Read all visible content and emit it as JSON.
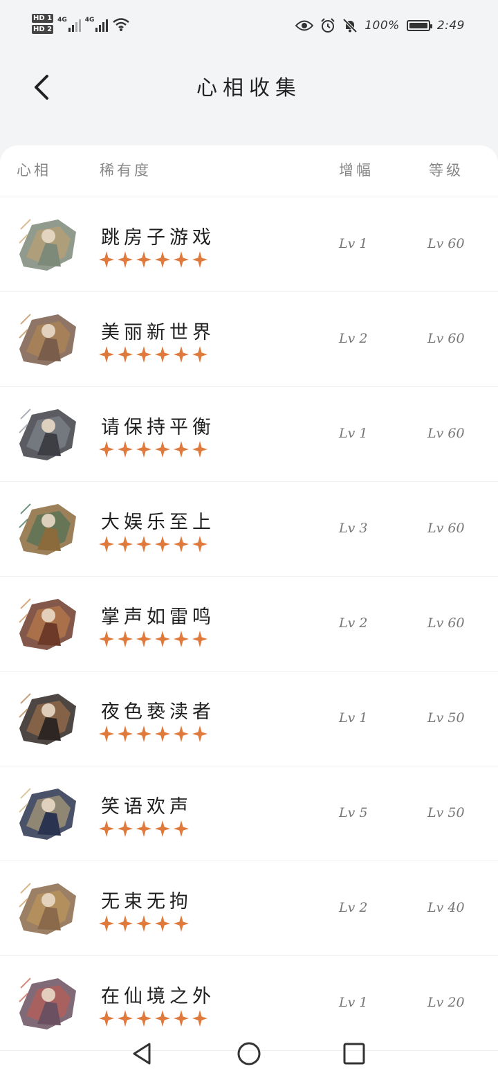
{
  "status_bar": {
    "hd1": "HD 1",
    "hd2": "HD 2",
    "net1": "4G",
    "net2": "4G",
    "battery": "100%",
    "time": "2:49"
  },
  "header": {
    "title": "心相收集"
  },
  "table": {
    "columns": [
      "心相",
      "稀有度",
      "增幅",
      "等级"
    ],
    "rows": [
      {
        "name": "跳房子游戏",
        "stars": 6,
        "boost": "Lv 1",
        "level": "Lv 60"
      },
      {
        "name": "美丽新世界",
        "stars": 6,
        "boost": "Lv 2",
        "level": "Lv 60"
      },
      {
        "name": "请保持平衡",
        "stars": 6,
        "boost": "Lv 1",
        "level": "Lv 60"
      },
      {
        "name": "大娱乐至上",
        "stars": 6,
        "boost": "Lv 3",
        "level": "Lv 60"
      },
      {
        "name": "掌声如雷鸣",
        "stars": 6,
        "boost": "Lv 2",
        "level": "Lv 60"
      },
      {
        "name": "夜色亵渎者",
        "stars": 6,
        "boost": "Lv 1",
        "level": "Lv 50"
      },
      {
        "name": "笑语欢声",
        "stars": 5,
        "boost": "Lv 5",
        "level": "Lv 50"
      },
      {
        "name": "无束无拘",
        "stars": 5,
        "boost": "Lv 2",
        "level": "Lv 40"
      },
      {
        "name": "在仙境之外",
        "stars": 6,
        "boost": "Lv 1",
        "level": "Lv 20"
      }
    ]
  },
  "colors": {
    "star": "#e07a3c",
    "background": "#f3f4f6",
    "card": "#ffffff"
  },
  "thumbs": [
    {
      "tone": "#7d8a7a",
      "accent": "#c9a16a"
    },
    {
      "tone": "#7a5d4b",
      "accent": "#b8884f"
    },
    {
      "tone": "#3d3f45",
      "accent": "#8a8f99"
    },
    {
      "tone": "#8b6a3c",
      "accent": "#3a6b52"
    },
    {
      "tone": "#6d3a2a",
      "accent": "#c9854a"
    },
    {
      "tone": "#2e2622",
      "accent": "#b07a4a"
    },
    {
      "tone": "#2a3450",
      "accent": "#c9b07a"
    },
    {
      "tone": "#8a6a4a",
      "accent": "#c99a5a"
    },
    {
      "tone": "#6a5060",
      "accent": "#c95a4a"
    }
  ],
  "icons": {
    "back": "chevron-left-icon",
    "nav_back": "triangle-back-icon",
    "nav_home": "circle-home-icon",
    "nav_recent": "square-recent-icon"
  }
}
